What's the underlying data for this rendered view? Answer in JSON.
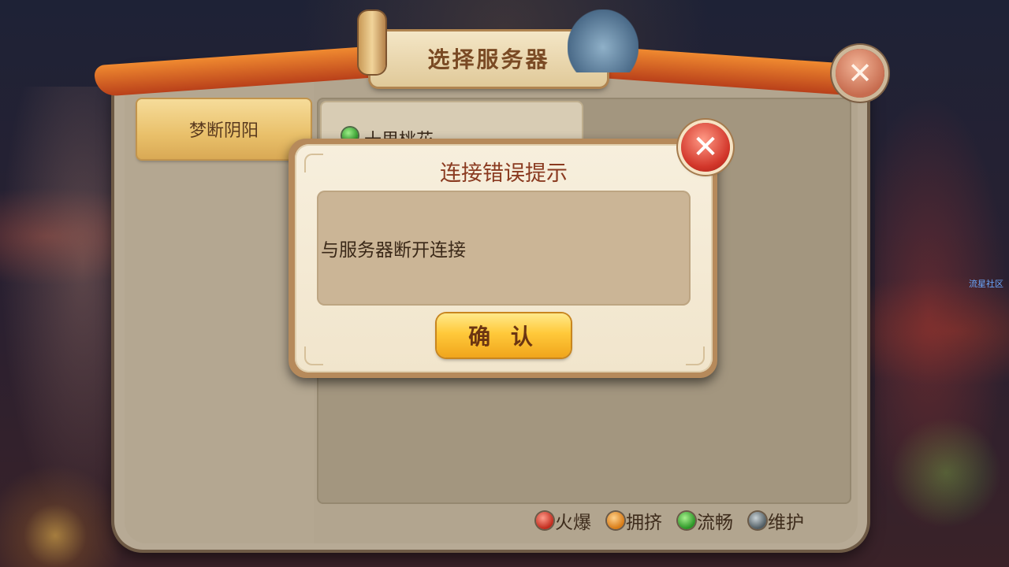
{
  "window": {
    "title": "选择服务器"
  },
  "server_panel": {
    "category_tab_label": "梦断阴阳",
    "servers": [
      {
        "name": "十里桃花",
        "status": "流畅",
        "status_color": "#2a9425"
      }
    ]
  },
  "legend": {
    "items": [
      {
        "label": "火爆",
        "color": "#c02a1c",
        "icon": "red-dot-icon"
      },
      {
        "label": "拥挤",
        "color": "#d77a14",
        "icon": "orange-dot-icon"
      },
      {
        "label": "流畅",
        "color": "#2a9425",
        "icon": "green-dot-icon"
      },
      {
        "label": "维护",
        "color": "#4f5b61",
        "icon": "gray-dot-icon"
      }
    ]
  },
  "dialog": {
    "title": "连接错误提示",
    "message": "与服务器断开连接",
    "confirm_label": "确 认"
  },
  "close_icon_glyph": "✕",
  "watermark": "流星社区",
  "colors": {
    "accent_gold": "#ffc93a",
    "title_red": "#8a3a20",
    "close_red": "#d2362a"
  }
}
